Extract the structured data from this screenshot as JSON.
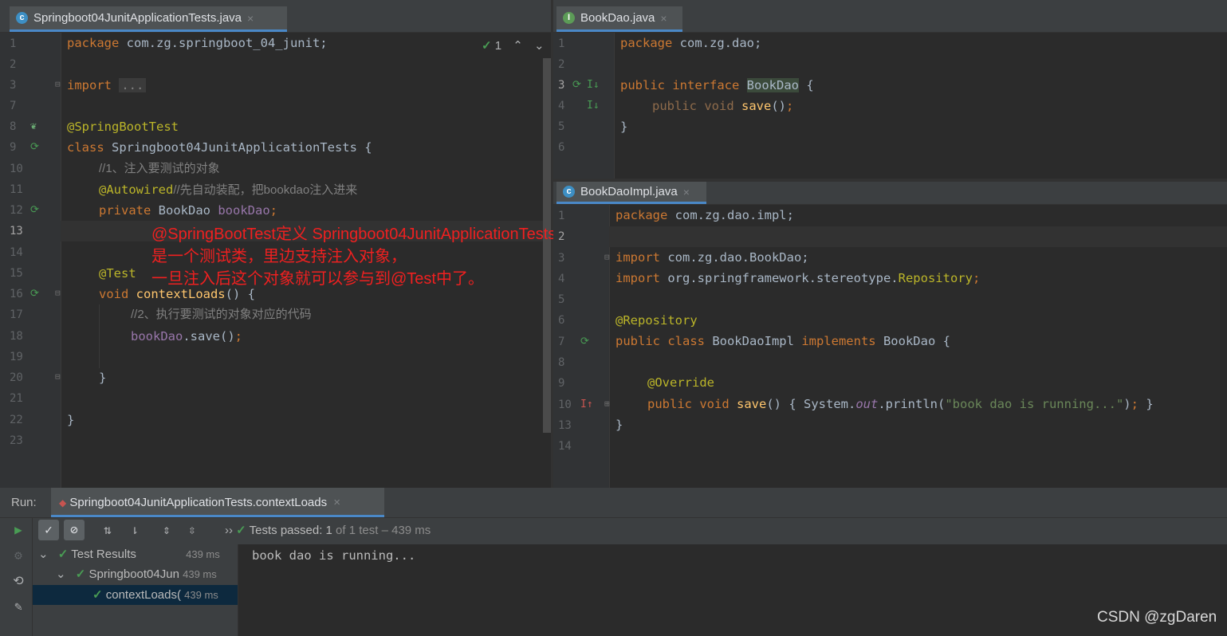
{
  "left_editor": {
    "tab": {
      "title": "Springboot04JunitApplicationTests.java",
      "icon": "java-class-icon",
      "close": "×"
    },
    "inspection": {
      "count": "1",
      "icon": "check-icon",
      "up": "⌃",
      "down": "⌄"
    },
    "line_numbers": [
      "1",
      "2",
      "3",
      "7",
      "8",
      "9",
      "10",
      "11",
      "12",
      "13",
      "14",
      "15",
      "16",
      "17",
      "18",
      "19",
      "20",
      "21",
      "22",
      "23"
    ],
    "lines": {
      "l1_kw": "package",
      "l1_rest": " com.zg.springboot_04_junit;",
      "l3_kw": "import",
      "l3_fold": "...",
      "l8": "@SpringBootTest",
      "l9_kw": "class",
      "l9_rest": " Springboot04JunitApplicationTests {",
      "l10": "//1、注入要测试的对象",
      "l11_ann": "@Autowired",
      "l11_cmt": "//先自动装配，把bookdao注入进来",
      "l12_kw": "private",
      "l12_type": " BookDao ",
      "l12_field": "bookDao",
      "l12_semi": ";",
      "l15": "@Test",
      "l16_kw": "void",
      "l16_method": " contextLoads",
      "l16_rest": "() {",
      "l17": "//2、执行要测试的对象对应的代码",
      "l18_field": "bookDao",
      "l18_rest": ".save()",
      "l18_semi": ";",
      "l20": "}",
      "l22": "}"
    },
    "overlay": [
      "@SpringBootTest定义 Springboot04JunitApplicationTests",
      "是一个测试类，里边支持注入对象，",
      "一旦注入后这个对象就可以参与到@Test中了。"
    ]
  },
  "right_top_editor": {
    "tab": {
      "title": "BookDao.java",
      "icon": "interface-icon",
      "close": "×"
    },
    "line_numbers": [
      "1",
      "2",
      "3",
      "4",
      "5",
      "6"
    ],
    "lines": {
      "l1_kw": "package",
      "l1_rest": " com.zg.dao;",
      "l3_kw": "public interface",
      "l3_name": "BookDao",
      "l3_rest": " {",
      "l4_kw": "public void",
      "l4_method": " save",
      "l4_rest": "()",
      "l4_semi": ";",
      "l5": "}"
    }
  },
  "right_bottom_editor": {
    "tab": {
      "title": "BookDaoImpl.java",
      "icon": "java-class-icon",
      "close": "×"
    },
    "line_numbers": [
      "1",
      "2",
      "3",
      "4",
      "5",
      "6",
      "7",
      "8",
      "9",
      "10",
      "13",
      "14"
    ],
    "lines": {
      "l1_kw": "package",
      "l1_rest": " com.zg.dao.impl;",
      "l3_kw": "import",
      "l3_rest": " com.zg.dao.BookDao;",
      "l4_kw": "import",
      "l4_rest": " org.springframework.stereotype.",
      "l4_ann": "Repository",
      "l4_semi": ";",
      "l6": "@Repository",
      "l7_kw": "public class",
      "l7_name": " BookDaoImpl ",
      "l7_kw2": "implements",
      "l7_rest": " BookDao {",
      "l9": "@Override",
      "l10_kw": "public void",
      "l10_method": " save",
      "l10_paren": "()",
      "l10_body": " { System.",
      "l10_out": "out",
      "l10_println": ".println(",
      "l10_str": "\"book dao is running...\"",
      "l10_close": ")",
      "l10_semi": ";",
      "l10_end": " }",
      "l13": "}"
    }
  },
  "run_panel": {
    "label": "Run:",
    "tab": "Springboot04JunitApplicationTests.contextLoads",
    "tab_close": "×",
    "status": {
      "prefix": "Tests passed: ",
      "count": "1",
      "suffix": " of 1 test – 439 ms"
    },
    "tree": [
      {
        "label": "Test Results",
        "time": "439 ms"
      },
      {
        "label": "Springboot04Jun",
        "time": "439 ms"
      },
      {
        "label": "contextLoads(",
        "time": "439 ms"
      }
    ],
    "console": "book dao is running...",
    "expand": "›› "
  },
  "watermark": "CSDN @zgDaren",
  "colors": {
    "keyword": "#cc7832",
    "annotation": "#bbb529",
    "method": "#ffc66d",
    "field": "#9876aa",
    "string": "#6a8759",
    "comment": "#808080",
    "overlay": "#ef2020",
    "pass": "#499c54"
  }
}
